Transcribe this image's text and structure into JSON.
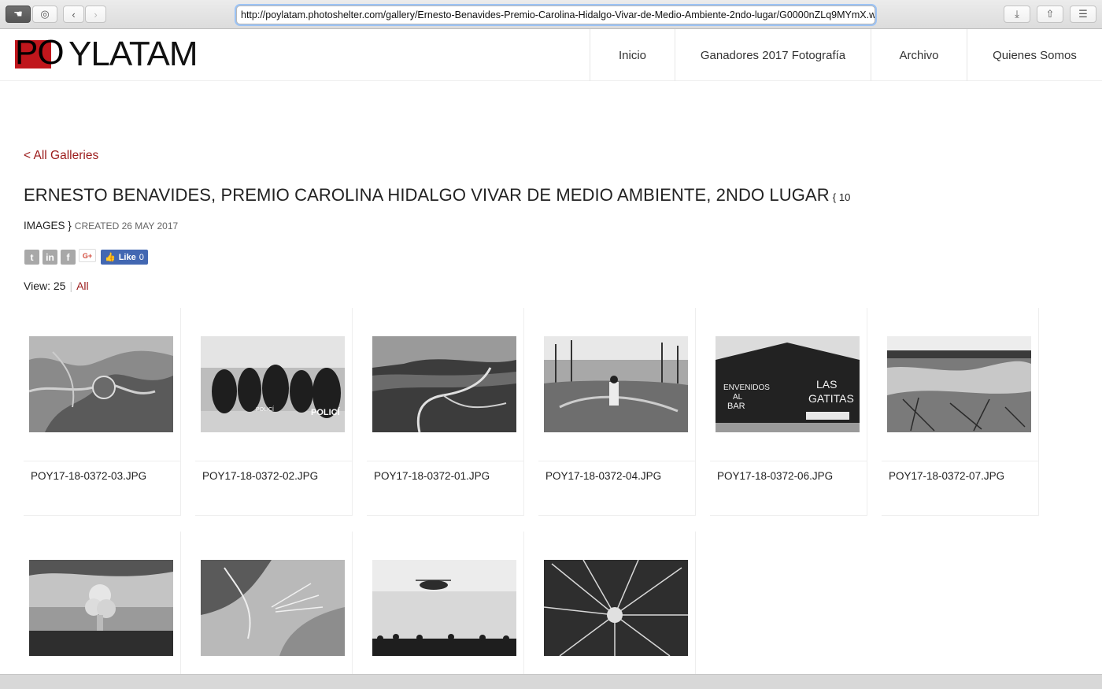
{
  "browser": {
    "url": "http://poylatam.photoshelter.com/gallery/Ernesto-Benavides-Premio-Carolina-Hidalgo-Vivar-de-Medio-Ambiente-2ndo-lugar/G0000nZLq9MYmX.w"
  },
  "site": {
    "logo_mark": "PO",
    "logo_rest": "YLATAM",
    "nav": [
      "Inicio",
      "Ganadores 2017 Fotografía",
      "Archivo",
      "Quienes Somos"
    ]
  },
  "gallery": {
    "back_label": "< All Galleries",
    "title": "ERNESTO BENAVIDES, PREMIO CAROLINA HIDALGO VIVAR DE MEDIO AMBIENTE, 2NDO LUGAR",
    "count_open": "{ 10",
    "count_close": "IMAGES }",
    "created": "CREATED 26 MAY 2017",
    "view_label": "View: 25",
    "view_all": "All",
    "fb_like": "Like",
    "fb_count": "0",
    "items": [
      {
        "filename": "POY17-18-0372-03.JPG"
      },
      {
        "filename": "POY17-18-0372-02.JPG"
      },
      {
        "filename": "POY17-18-0372-01.JPG"
      },
      {
        "filename": "POY17-18-0372-04.JPG"
      },
      {
        "filename": "POY17-18-0372-06.JPG"
      },
      {
        "filename": "POY17-18-0372-07.JPG"
      },
      {
        "filename": ""
      },
      {
        "filename": ""
      },
      {
        "filename": ""
      },
      {
        "filename": ""
      }
    ],
    "photo4_text_left": "ENVENIDOS AL BAR",
    "photo4_text_right": "LAS GATITAS"
  },
  "icons": {
    "social": [
      "twitter-icon",
      "linkedin-icon",
      "facebook-icon",
      "google-plus-icon"
    ]
  },
  "colors": {
    "accent": "#9b1b1b",
    "logo_red": "#c0161c",
    "facebook": "#4267b2"
  }
}
